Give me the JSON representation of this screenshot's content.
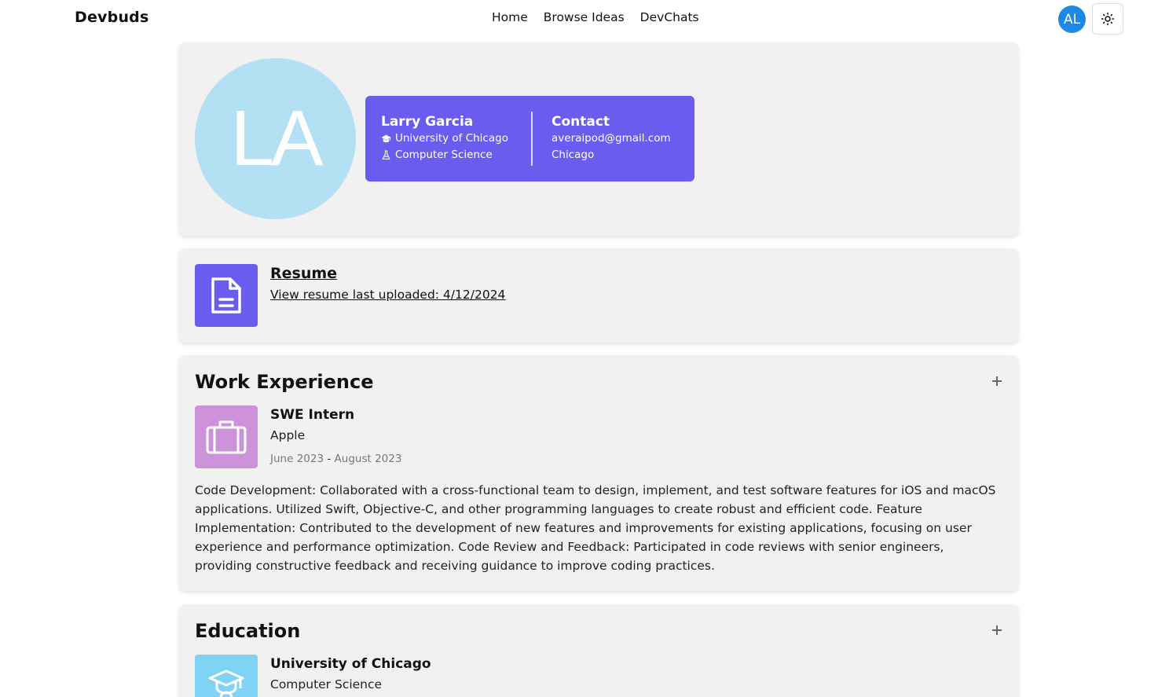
{
  "nav": {
    "brand": "Devbuds",
    "links": [
      "Home",
      "Browse Ideas",
      "DevChats"
    ],
    "avatar_initials": "AL",
    "theme_icon": "sun-icon"
  },
  "profile": {
    "initials": "LA",
    "name": "Larry Garcia",
    "university": "University of Chicago",
    "major": "Computer Science",
    "contact_heading": "Contact",
    "email": "averaipod@gmail.com",
    "city": "Chicago"
  },
  "resume": {
    "title": "Resume",
    "link_text": "View resume last uploaded: 4/12/2024",
    "icon": "document-icon"
  },
  "work": {
    "heading": "Work Experience",
    "add_icon": "plus-icon",
    "entries": [
      {
        "title": "SWE Intern",
        "company": "Apple",
        "start": "June 2023",
        "separator": "-",
        "end": "August 2023",
        "icon": "briefcase-icon",
        "description": "Code Development: Collaborated with a cross-functional team to design, implement, and test software features for iOS and macOS applications. Utilized Swift, Objective-C, and other programming languages to create robust and efficient code. Feature Implementation: Contributed to the development of new features and improvements for existing applications, focusing on user experience and performance optimization. Code Review and Feedback: Participated in code reviews with senior engineers, providing constructive feedback and receiving guidance to improve coding practices."
      }
    ]
  },
  "education": {
    "heading": "Education",
    "add_icon": "plus-icon",
    "entries": [
      {
        "school": "University of Chicago",
        "major": "Computer Science",
        "icon": "graduation-cap-icon"
      }
    ]
  },
  "colors": {
    "accent": "#6b5cf0",
    "avatar_bg": "#b3e0f2",
    "work_tile": "#cc93db",
    "edu_tile": "#7fd3f5",
    "nav_avatar": "#1e88e5",
    "card_bg": "#f1f1f1"
  }
}
